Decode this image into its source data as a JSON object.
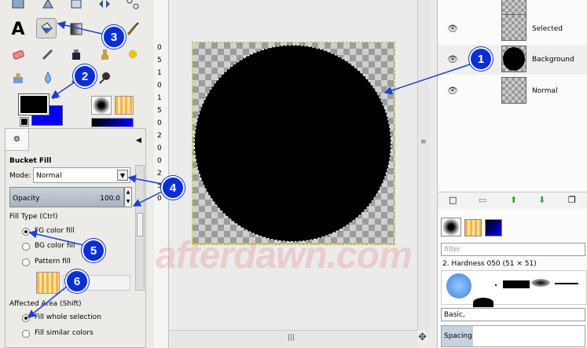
{
  "tool_options": {
    "title": "Bucket Fill",
    "mode_label": "Mode:",
    "mode_value": "Normal",
    "opacity_label": "Opacity",
    "opacity_value": "100.0",
    "fill_type_label": "Fill Type  (Ctrl)",
    "fill_types": [
      "FG color fill",
      "BG color fill",
      "Pattern fill"
    ],
    "affected_area_label": "Affected Area  (Shift)",
    "affected_areas": [
      "Fill whole selection",
      "Fill similar colors"
    ]
  },
  "layers": [
    {
      "name": "Selected"
    },
    {
      "name": "Background"
    },
    {
      "name": "Normal"
    }
  ],
  "brushes": {
    "filter_placeholder": "filter",
    "selected_brush": "2. Hardness 050 (51 × 51)",
    "tag": "Basic,",
    "spacing_label": "Spacing"
  },
  "ruler_labels": [
    "0",
    "5",
    "1",
    "0",
    "1",
    "5",
    "0",
    "2",
    "0",
    "0",
    "2",
    "5",
    "0"
  ],
  "callouts": [
    "1",
    "2",
    "3",
    "4",
    "5",
    "6"
  ],
  "watermark": "afterdawn.com",
  "colors": {
    "fg": "#000000",
    "bg": "#0000ff",
    "callout": "#0b2fd6",
    "arrow": "#1f3fd0"
  },
  "icons": [
    "text-tool-icon",
    "bucket-fill-icon",
    "blend-icon",
    "paintbrush-icon",
    "eraser-icon",
    "airbrush-icon",
    "ink-icon",
    "clone-icon",
    "heal-icon",
    "smudge-icon",
    "blur-icon",
    "dodge-icon",
    "eye-icon"
  ]
}
